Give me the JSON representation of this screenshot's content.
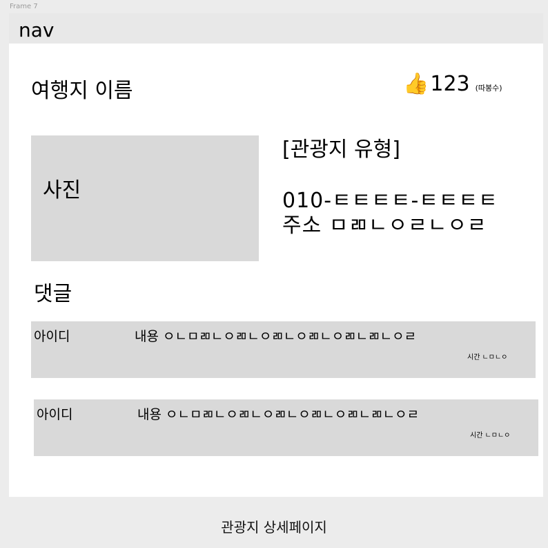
{
  "frame_label": "Frame 7",
  "nav": {
    "label": "nav"
  },
  "place": {
    "name": "여행지 이름",
    "likes": {
      "icon": "thumbs-up-icon",
      "count": "123",
      "note": "(따봉수)"
    },
    "photo_label": "사진",
    "type": "[관광지 유형]",
    "phone": "010-ㅌㅌㅌㅌ-ㅌㅌㅌㅌ",
    "address": "주소 ㅁㄻㄴㅇㄹㄴㅇㄹ"
  },
  "comments": {
    "heading": "댓글",
    "items": [
      {
        "user": "아이디",
        "content": "내용 ㅇㄴㅁㄻㄴㅇㄻㄴㅇㄻㄴㅇㄻㄴㅇㄻㄴㄻㄴㅇㄹ",
        "time": "시간 ㄴㅁㄴㅇ"
      },
      {
        "user": "아이디",
        "content": "내용 ㅇㄴㅁㄻㄴㅇㄻㄴㅇㄻㄴㅇㄻㄴㅇㄻㄴㄻㄴㅇㄹ",
        "time": "시간 ㄴㅁㄴㅇ"
      }
    ]
  },
  "caption": "관광지 상세페이지",
  "colors": {
    "frame_bg": "#ffffff",
    "canvas_bg": "#ececec",
    "block_gray": "#d9d9d9",
    "nav_bg": "#e8e8e8"
  }
}
